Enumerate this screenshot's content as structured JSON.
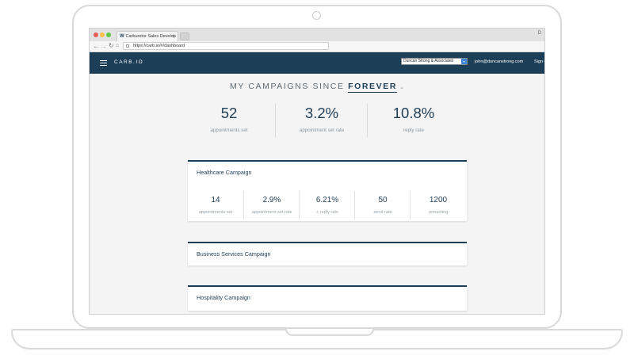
{
  "browser": {
    "tab_title": "Carburetor Sales Develop",
    "tab_close": "×",
    "url": "https://carb.io/#/dashboard",
    "corner_letter": "D"
  },
  "header": {
    "brand": "CARB.IO",
    "account_selected": "Duncan Strong & Associates",
    "user_email": "john@duncanstrong.com",
    "sign_out": "Sign O"
  },
  "heading": {
    "prefix": "MY CAMPAIGNS SINCE",
    "period": "FOREVER",
    "chevron": "⌄"
  },
  "summary": [
    {
      "value": "52",
      "label": "appointments set"
    },
    {
      "value": "3.2%",
      "label": "appointment set rate"
    },
    {
      "value": "10.8%",
      "label": "reply rate"
    }
  ],
  "campaigns": [
    {
      "name": "Healthcare Campaign",
      "stats": [
        {
          "value": "14",
          "label": "appointments set"
        },
        {
          "value": "2.9%",
          "label": "appointment set rate"
        },
        {
          "value": "6.21%",
          "label": "+ reply rate"
        },
        {
          "value": "50",
          "label": "send rate"
        },
        {
          "value": "1200",
          "label": "remaining"
        }
      ]
    },
    {
      "name": "Business Services Campaign"
    },
    {
      "name": "Hospitality Campaign"
    }
  ]
}
